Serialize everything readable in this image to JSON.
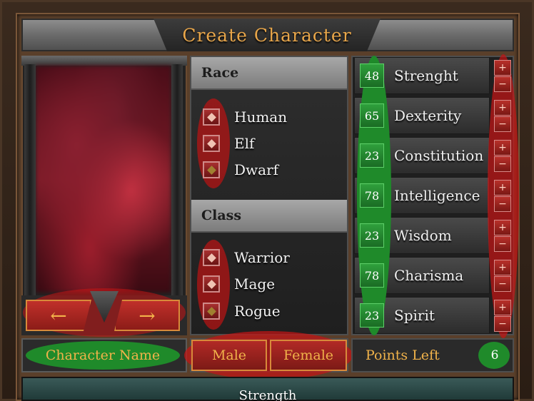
{
  "title": "Create Character",
  "portrait": {
    "prev_icon": "left-arrow-icon",
    "next_icon": "right-arrow-icon",
    "prev_glyph": "←",
    "next_glyph": "→"
  },
  "name_field": {
    "value": "Character Name"
  },
  "race": {
    "header": "Race",
    "options": [
      "Human",
      "Elf",
      "Dwarf"
    ],
    "selected": "Dwarf"
  },
  "class": {
    "header": "Class",
    "options": [
      "Warrior",
      "Mage",
      "Rogue"
    ],
    "selected": "Rogue"
  },
  "gender": {
    "male": "Male",
    "female": "Female"
  },
  "stats": [
    {
      "name": "Strenght",
      "value": "48"
    },
    {
      "name": "Dexterity",
      "value": "65"
    },
    {
      "name": "Constitution",
      "value": "23"
    },
    {
      "name": "Intelligence",
      "value": "78"
    },
    {
      "name": "Wisdom",
      "value": "23"
    },
    {
      "name": "Charisma",
      "value": "78"
    },
    {
      "name": "Spirit",
      "value": "23"
    }
  ],
  "stat_buttons": {
    "plus": "+",
    "minus": "−"
  },
  "points_left": {
    "label": "Points Left",
    "value": "6"
  },
  "description": {
    "text": "Strength"
  },
  "colors": {
    "gold_text": "#f0b24a",
    "highlight_red": "#c81414",
    "highlight_green": "#1f8a2a"
  }
}
